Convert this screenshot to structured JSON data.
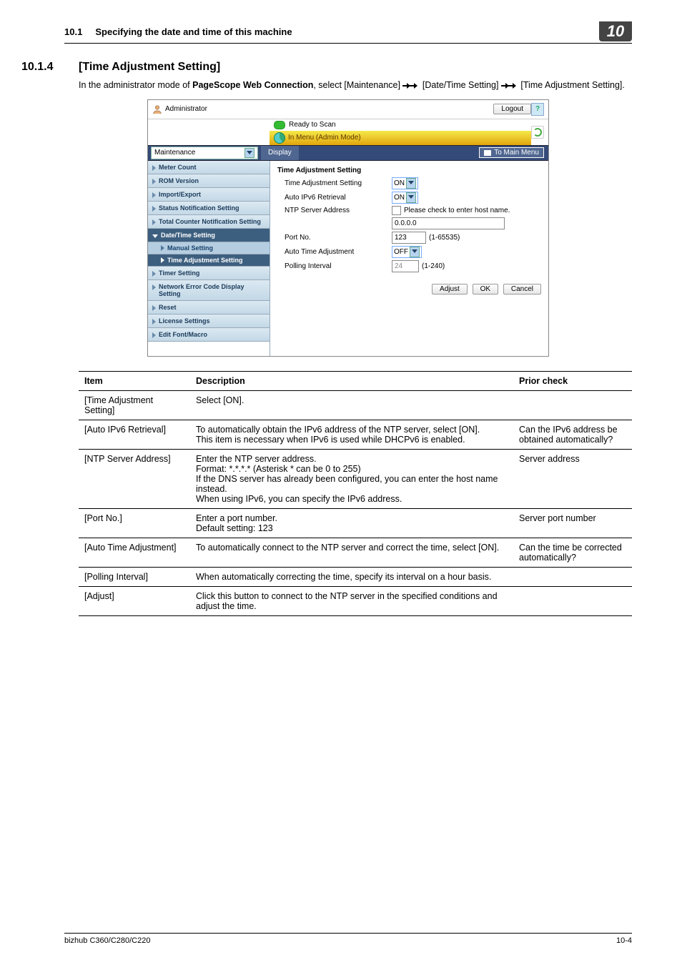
{
  "header": {
    "left_num": "10.1",
    "left_text": "Specifying the date and time of this machine",
    "badge": "10"
  },
  "section": {
    "num": "10.1.4",
    "title": "[Time Adjustment Setting]"
  },
  "intro": {
    "prefix": "In the administrator mode of ",
    "bold": "PageScope Web Connection",
    "mid": ", select [Maintenance] ",
    "mid2": " [Date/Time Setting] ",
    "suffix": "[Time Adjustment Setting]."
  },
  "mock": {
    "user": "Administrator",
    "logout": "Logout",
    "help": "?",
    "status": "Ready to Scan",
    "adminband": "In Menu (Admin Mode)",
    "category": "Maintenance",
    "tab_display": "Display",
    "to_main": "To Main Menu",
    "side": {
      "items": [
        "Meter Count",
        "ROM Version",
        "Import/Export",
        "Status Notification Setting",
        "Total Counter Notification Setting",
        "Date/Time Setting",
        "Timer Setting",
        "Network Error Code Display Setting",
        "Reset",
        "License Settings",
        "Edit Font/Macro"
      ],
      "subs": [
        "Manual Setting",
        "Time Adjustment Setting"
      ]
    },
    "main_heading": "Time Adjustment Setting",
    "rows": {
      "r1_lbl": "Time Adjustment Setting",
      "r1_val": "ON",
      "r2_lbl": "Auto IPv6 Retrieval",
      "r2_val": "ON",
      "r3_lbl": "NTP Server Address",
      "r3_hint": "Please check to enter host name.",
      "r3_ip": "0.0.0.0",
      "r4_lbl": "Port No.",
      "r4_val": "123",
      "r4_range": "(1-65535)",
      "r5_lbl": "Auto Time Adjustment",
      "r5_val": "OFF",
      "r6_lbl": "Polling Interval",
      "r6_val": "24",
      "r6_range": "(1-240)"
    },
    "buttons": {
      "adjust": "Adjust",
      "ok": "OK",
      "cancel": "Cancel"
    }
  },
  "table": {
    "h_item": "Item",
    "h_desc": "Description",
    "h_prior": "Prior check",
    "rows": [
      {
        "item": "[Time Adjustment Setting]",
        "desc": "Select [ON].",
        "prior": ""
      },
      {
        "item": "[Auto IPv6 Retrieval]",
        "desc": "To automatically obtain the IPv6 address of the NTP server, select [ON].\nThis item is necessary when IPv6 is used while DHCPv6 is enabled.",
        "prior": "Can the IPv6 address be obtained automatically?"
      },
      {
        "item": "[NTP Server Address]",
        "desc": "Enter the NTP server address.\nFormat: *.*.*.* (Asterisk * can be 0 to 255)\nIf the DNS server has already been configured, you can enter the host name instead.\nWhen using IPv6, you can specify the IPv6 address.",
        "prior": "Server address"
      },
      {
        "item": "[Port No.]",
        "desc": "Enter a port number.\nDefault setting: 123",
        "prior": "Server port number"
      },
      {
        "item": "[Auto Time Adjustment]",
        "desc": "To automatically connect to the NTP server and correct the time, select [ON].",
        "prior": "Can the time be corrected automatically?"
      },
      {
        "item": "[Polling Interval]",
        "desc": "When automatically correcting the time, specify its interval on a hour basis.",
        "prior": ""
      },
      {
        "item": "[Adjust]",
        "desc": "Click this button to connect to the NTP server in the specified conditions and adjust the time.",
        "prior": ""
      }
    ]
  },
  "footer": {
    "left": "bizhub C360/C280/C220",
    "right": "10-4"
  }
}
